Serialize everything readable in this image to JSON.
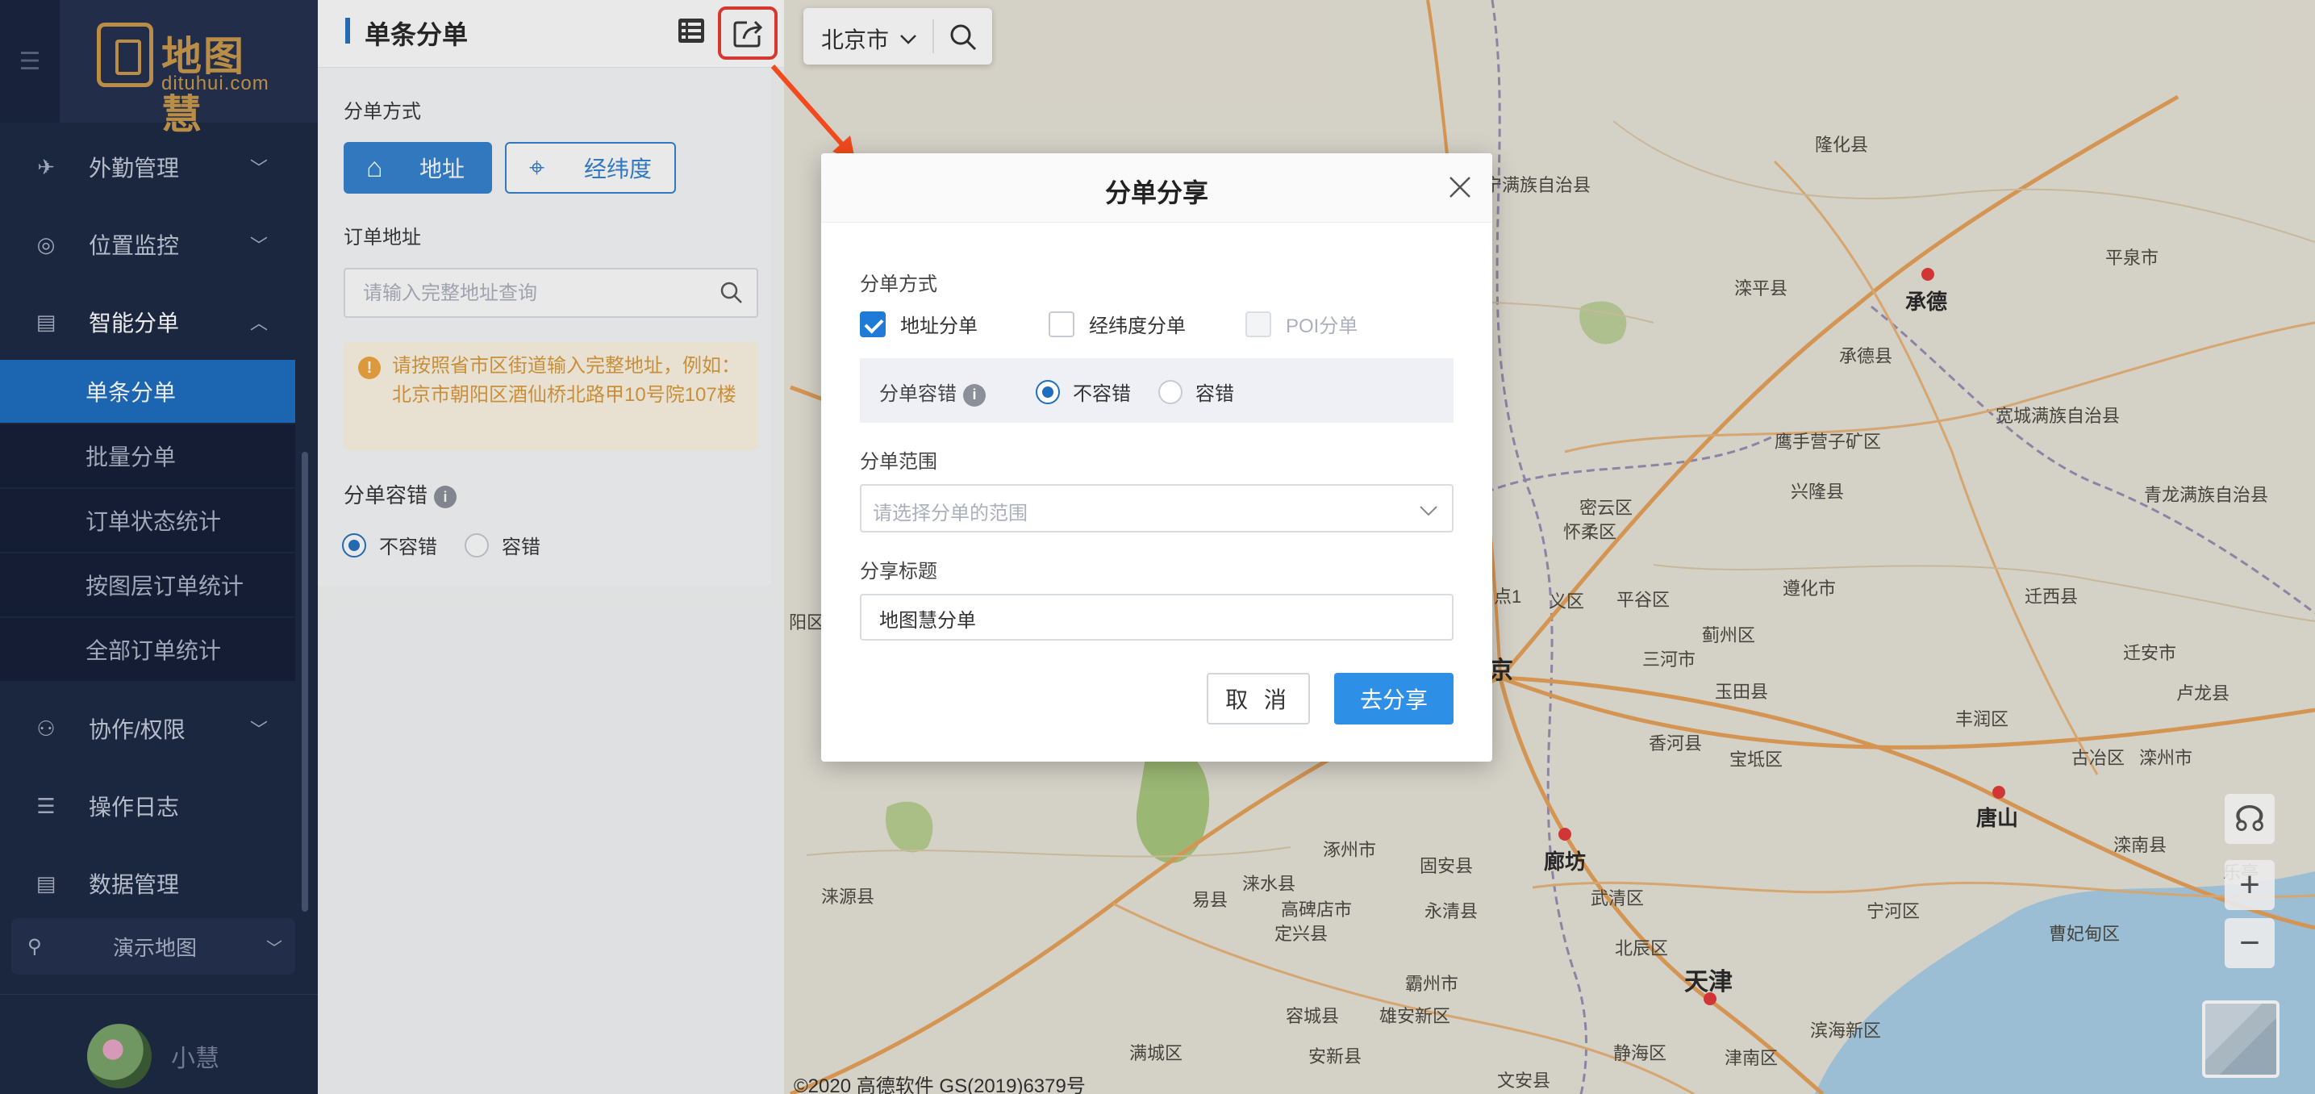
{
  "sidebar": {
    "logo_cn": "地图慧",
    "logo_en": "dituhui.com",
    "items": [
      {
        "label": "外勤管理",
        "icon": "field-service-icon"
      },
      {
        "label": "位置监控",
        "icon": "location-monitor-icon"
      },
      {
        "label": "智能分单",
        "icon": "smart-dispatch-icon",
        "expanded": true
      },
      {
        "label": "协作/权限",
        "icon": "collaboration-icon"
      },
      {
        "label": "操作日志",
        "icon": "log-icon"
      },
      {
        "label": "数据管理",
        "icon": "data-management-icon"
      }
    ],
    "sub_items": [
      {
        "label": "单条分单",
        "active": true
      },
      {
        "label": "批量分单"
      },
      {
        "label": "订单状态统计"
      },
      {
        "label": "按图层订单统计"
      },
      {
        "label": "全部订单统计"
      }
    ],
    "demo_map": "演示地图",
    "username": "小慧"
  },
  "panel": {
    "title": "单条分单",
    "mode_label": "分单方式",
    "mode_address": "地址",
    "mode_latlng": "经纬度",
    "order_address_label": "订单地址",
    "address_placeholder": "请输入完整地址查询",
    "warning": "请按照省市区街道输入完整地址，例如：北京市朝阳区酒仙桥北路甲10号院107楼",
    "tolerance_label": "分单容错",
    "tolerance_no": "不容错",
    "tolerance_yes": "容错"
  },
  "map": {
    "city": "北京市",
    "copyright": "©2020 高德软件 GS(2019)6379号",
    "labels": [
      {
        "text": "隆化县",
        "cls": ""
      },
      {
        "text": "宁满族自治县",
        "cls": ""
      },
      {
        "text": "平泉市",
        "cls": ""
      },
      {
        "text": "滦平县",
        "cls": ""
      },
      {
        "text": "承德",
        "cls": "city"
      },
      {
        "text": "承德县",
        "cls": ""
      },
      {
        "text": "宽城满族自治县",
        "cls": ""
      },
      {
        "text": "鹰手营子矿区",
        "cls": ""
      },
      {
        "text": "兴隆县",
        "cls": ""
      },
      {
        "text": "青龙满族自治县",
        "cls": ""
      },
      {
        "text": "密云区",
        "cls": ""
      },
      {
        "text": "怀柔区",
        "cls": ""
      },
      {
        "text": "平谷区",
        "cls": ""
      },
      {
        "text": "遵化市",
        "cls": ""
      },
      {
        "text": "迁西县",
        "cls": ""
      },
      {
        "text": "义区",
        "cls": ""
      },
      {
        "text": "点1",
        "cls": ""
      },
      {
        "text": "三河市",
        "cls": ""
      },
      {
        "text": "蓟州区",
        "cls": ""
      },
      {
        "text": "迁安市",
        "cls": ""
      },
      {
        "text": "玉田县",
        "cls": ""
      },
      {
        "text": "卢龙县",
        "cls": ""
      },
      {
        "text": "京",
        "cls": "big"
      },
      {
        "text": "香河县",
        "cls": ""
      },
      {
        "text": "宝坻区",
        "cls": ""
      },
      {
        "text": "丰润区",
        "cls": ""
      },
      {
        "text": "古冶区",
        "cls": ""
      },
      {
        "text": "滦州市",
        "cls": ""
      },
      {
        "text": "唐山",
        "cls": "city"
      },
      {
        "text": "滦南县",
        "cls": ""
      },
      {
        "text": "涿州市",
        "cls": ""
      },
      {
        "text": "固安县",
        "cls": ""
      },
      {
        "text": "廊坊",
        "cls": "city"
      },
      {
        "text": "涞水县",
        "cls": ""
      },
      {
        "text": "涞源县",
        "cls": ""
      },
      {
        "text": "易县",
        "cls": ""
      },
      {
        "text": "高碑店市",
        "cls": ""
      },
      {
        "text": "定兴县",
        "cls": ""
      },
      {
        "text": "永清县",
        "cls": ""
      },
      {
        "text": "武清区",
        "cls": ""
      },
      {
        "text": "宁河区",
        "cls": ""
      },
      {
        "text": "曹妃甸区",
        "cls": ""
      },
      {
        "text": "乐亭",
        "cls": ""
      },
      {
        "text": "北辰区",
        "cls": ""
      },
      {
        "text": "天津",
        "cls": "big"
      },
      {
        "text": "霸州市",
        "cls": ""
      },
      {
        "text": "容城县",
        "cls": ""
      },
      {
        "text": "雄安新区",
        "cls": ""
      },
      {
        "text": "滨海新区",
        "cls": ""
      },
      {
        "text": "满城区",
        "cls": ""
      },
      {
        "text": "安新县",
        "cls": ""
      },
      {
        "text": "静海区",
        "cls": ""
      },
      {
        "text": "津南区",
        "cls": ""
      },
      {
        "text": "文安县",
        "cls": ""
      },
      {
        "text": "阳区",
        "cls": ""
      }
    ]
  },
  "modal": {
    "title": "分单分享",
    "mode_label": "分单方式",
    "opt_address": "地址分单",
    "opt_latlng": "经纬度分单",
    "opt_poi": "POI分单",
    "tolerance_label": "分单容错",
    "tolerance_no": "不容错",
    "tolerance_yes": "容错",
    "range_label": "分单范围",
    "range_placeholder": "请选择分单的范围",
    "title_label": "分享标题",
    "title_value": "地图慧分单",
    "cancel": "取 消",
    "share": "去分享"
  }
}
